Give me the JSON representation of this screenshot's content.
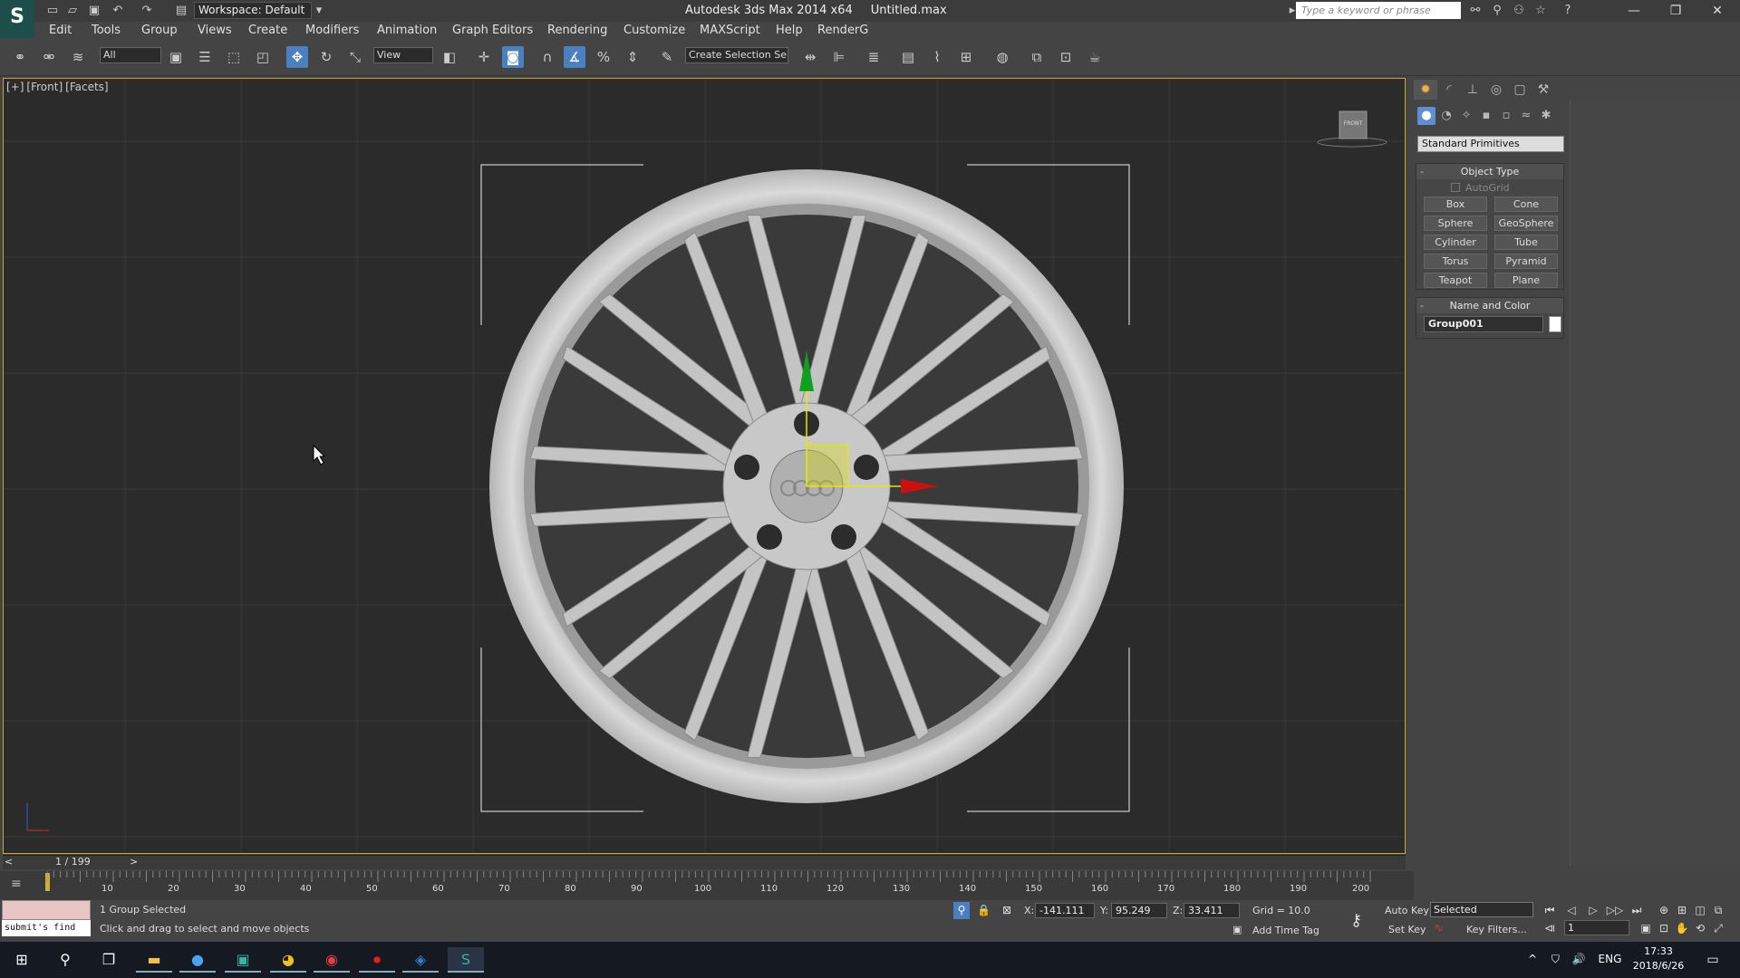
{
  "titlebar": {
    "workspace": "Workspace: Default",
    "app_title": "Autodesk 3ds Max  2014 x64",
    "file_name": "Untitled.max",
    "search_placeholder": "Type a keyword or phrase"
  },
  "menu": [
    "Edit",
    "Tools",
    "Group",
    "Views",
    "Create",
    "Modifiers",
    "Animation",
    "Graph Editors",
    "Rendering",
    "Customize",
    "MAXScript",
    "Help",
    "RenderG"
  ],
  "toolbar": {
    "selection_filter": "All",
    "ref_coord": "View",
    "named_selection": "Create Selection Se"
  },
  "viewport": {
    "label_plus": "[+]",
    "label_view": "[Front]",
    "label_shading": "[Facets]",
    "viewcube_label": "FRONT"
  },
  "command_panel": {
    "category": "Standard Primitives",
    "object_type_title": "Object Type",
    "autogrid": "AutoGrid",
    "primitives": [
      "Box",
      "Cone",
      "Sphere",
      "GeoSphere",
      "Cylinder",
      "Tube",
      "Torus",
      "Pyramid",
      "Teapot",
      "Plane"
    ],
    "name_color_title": "Name and Color",
    "object_name": "Group001",
    "object_color": "#ffffff"
  },
  "timeline": {
    "frame_indicator": "1 / 199",
    "ticks": [
      "10",
      "20",
      "30",
      "40",
      "50",
      "60",
      "70",
      "80",
      "90",
      "100",
      "110",
      "120",
      "130",
      "140",
      "150",
      "160",
      "170",
      "180",
      "190",
      "200"
    ]
  },
  "status": {
    "listener_text": "submit's find",
    "selection_status": "1 Group Selected",
    "prompt": "Click and drag to select and move objects",
    "x_label": "X:",
    "x": "-141.111",
    "y_label": "Y:",
    "y": "95.249",
    "z_label": "Z:",
    "z": "33.411",
    "grid": "Grid = 10.0",
    "add_time_tag": "Add Time Tag",
    "auto_key": "Auto Key",
    "set_key": "Set Key",
    "key_mode": "Selected",
    "key_filters": "Key Filters...",
    "current_frame": "1"
  },
  "taskbar": {
    "language": "ENG",
    "time": "17:33",
    "date": "2018/6/26"
  },
  "colors": {
    "viewport_bg": "#2b2b2b",
    "active_tool": "#4a80c0",
    "axis_x": "#cc1010",
    "axis_y": "#10a020"
  }
}
